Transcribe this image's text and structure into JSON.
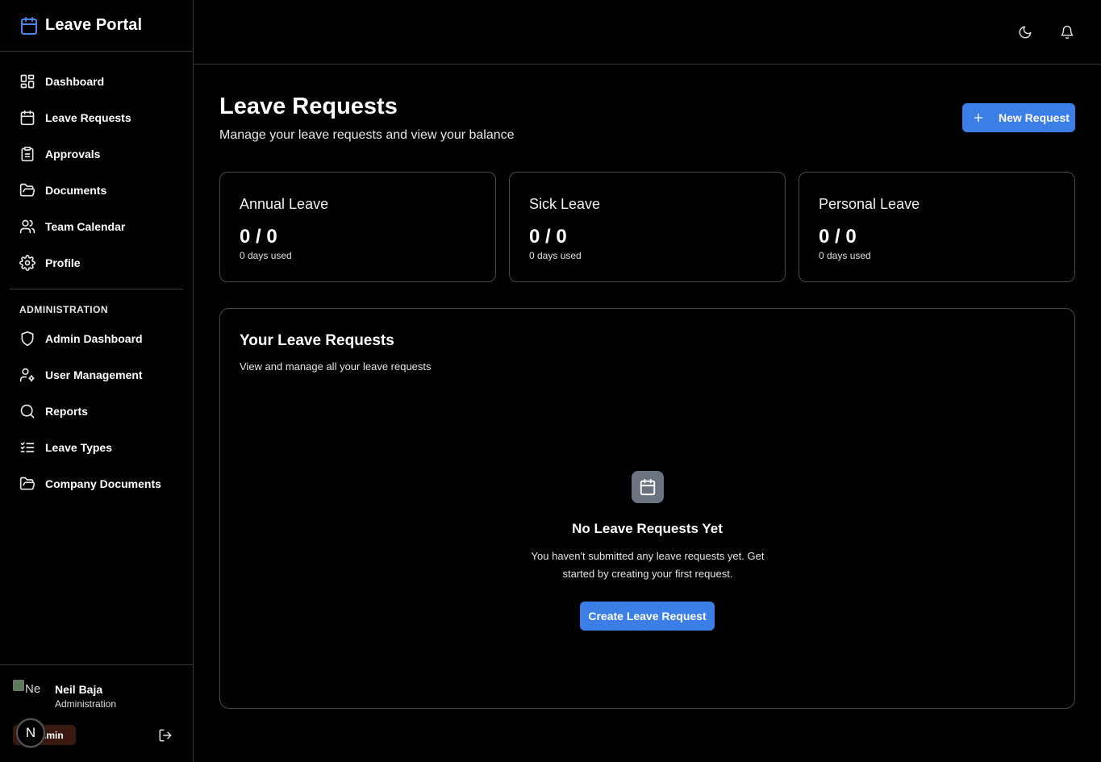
{
  "app": {
    "name": "Leave Portal",
    "logo_icon": "calendar-icon",
    "accent": "#3b7ee6"
  },
  "sidebar": {
    "items": [
      {
        "label": "Dashboard",
        "icon": "dashboard-grid-icon"
      },
      {
        "label": "Leave Requests",
        "icon": "calendar-icon"
      },
      {
        "label": "Approvals",
        "icon": "clipboard-icon"
      },
      {
        "label": "Documents",
        "icon": "folder-open-icon"
      },
      {
        "label": "Team Calendar",
        "icon": "users-icon"
      },
      {
        "label": "Profile",
        "icon": "gear-icon"
      }
    ],
    "admin_section_title": "ADMINISTRATION",
    "admin_items": [
      {
        "label": "Admin Dashboard",
        "icon": "shield-icon"
      },
      {
        "label": "User Management",
        "icon": "user-cog-icon"
      },
      {
        "label": "Reports",
        "icon": "search-icon"
      },
      {
        "label": "Leave Types",
        "icon": "list-checks-icon"
      },
      {
        "label": "Company Documents",
        "icon": "folder-open-icon"
      }
    ]
  },
  "user": {
    "avatar_alt": "Ne",
    "name": "Neil Baja",
    "role": "Administration",
    "badge": "dmin",
    "fab_letter": "N"
  },
  "topbar": {
    "icons": [
      "moon-icon",
      "bell-icon"
    ]
  },
  "page": {
    "title": "Leave Requests",
    "subtitle": "Manage your leave requests and view your balance",
    "new_button": "New Request"
  },
  "balances": [
    {
      "title": "Annual Leave",
      "value": "0 / 0",
      "used": "0 days used"
    },
    {
      "title": "Sick Leave",
      "value": "0 / 0",
      "used": "0 days used"
    },
    {
      "title": "Personal Leave",
      "value": "0 / 0",
      "used": "0 days used"
    }
  ],
  "requests": {
    "title": "Your Leave Requests",
    "subtitle": "View and manage all your leave requests",
    "empty_title": "No Leave Requests Yet",
    "empty_text": "You haven't submitted any leave requests yet. Get started by creating your first request.",
    "create_button": "Create Leave Request"
  }
}
